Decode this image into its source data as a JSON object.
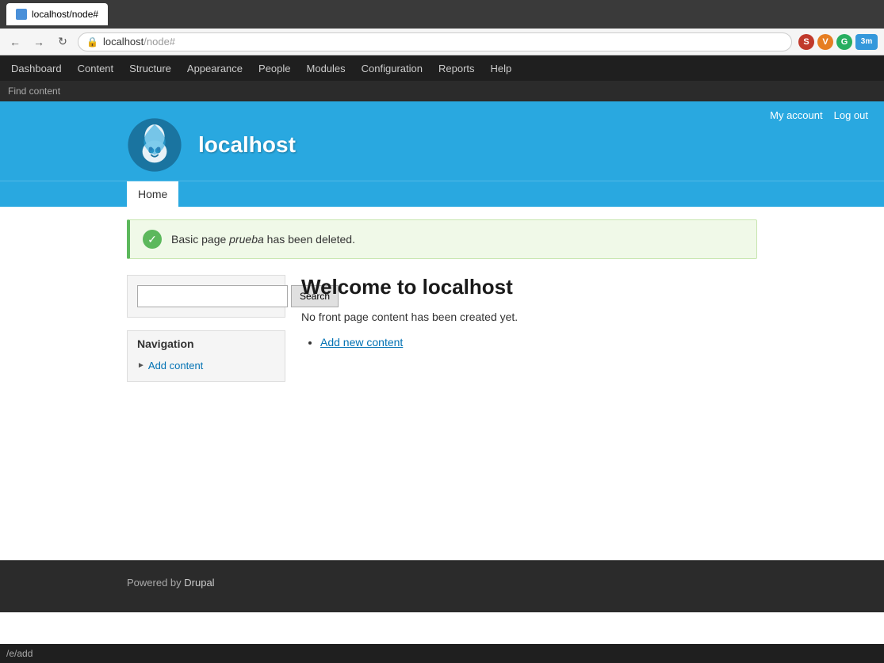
{
  "browser": {
    "tab_title": "localhost/node#",
    "url": "localhost/node#",
    "url_host": "localhost",
    "url_path": "/node#"
  },
  "admin_toolbar": {
    "items": [
      {
        "id": "dashboard",
        "label": "Dashboard"
      },
      {
        "id": "content",
        "label": "Content"
      },
      {
        "id": "structure",
        "label": "Structure"
      },
      {
        "id": "appearance",
        "label": "Appearance"
      },
      {
        "id": "people",
        "label": "People"
      },
      {
        "id": "modules",
        "label": "Modules"
      },
      {
        "id": "configuration",
        "label": "Configuration"
      },
      {
        "id": "reports",
        "label": "Reports"
      },
      {
        "id": "help",
        "label": "Help"
      }
    ]
  },
  "shortcuts": {
    "label": "Find content"
  },
  "site": {
    "name": "localhost",
    "logo_alt": "Drupal logo"
  },
  "user_links": {
    "my_account": "My account",
    "log_out": "Log out"
  },
  "primary_nav": {
    "home": "Home"
  },
  "status_message": {
    "prefix": "Basic page ",
    "page_name": "prueba",
    "suffix": " has been deleted."
  },
  "search": {
    "placeholder": "",
    "button_label": "Search"
  },
  "navigation_block": {
    "title": "Navigation",
    "add_content": "Add content"
  },
  "main": {
    "title": "Welcome to localhost",
    "body": "No front page content has been created yet.",
    "add_new_content": "Add new content"
  },
  "footer": {
    "powered_by": "Powered by ",
    "drupal": "Drupal"
  },
  "status_bar": {
    "url": "/e/add"
  }
}
